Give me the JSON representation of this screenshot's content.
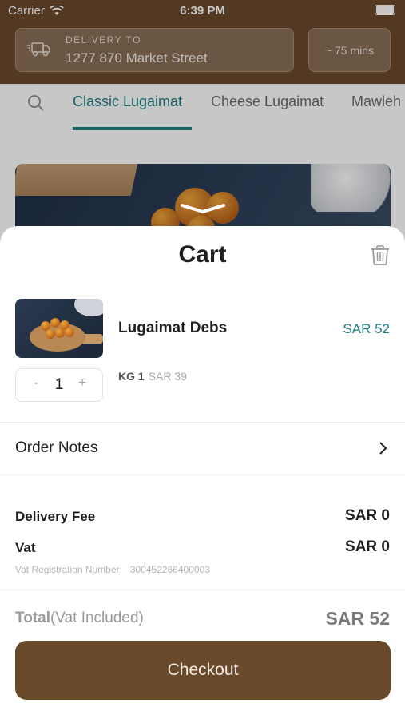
{
  "status_bar": {
    "carrier": "Carrier",
    "time": "6:39 PM"
  },
  "header": {
    "delivery_label": "DELIVERY TO",
    "delivery_address": "1277 870 Market Street",
    "eta": "~ 75 mins"
  },
  "tabs": [
    {
      "label": "Classic Lugaimat",
      "active": true
    },
    {
      "label": "Cheese Lugaimat",
      "active": false
    },
    {
      "label": "Mawleh",
      "active": false
    }
  ],
  "colors": {
    "brand_brown": "#6b4a2c",
    "accent_teal": "#1f7d82"
  },
  "cart": {
    "title": "Cart",
    "item": {
      "name": "Lugaimat Debs",
      "price": "SAR 52",
      "quantity": "1",
      "unit": "KG 1",
      "unit_price": "SAR 39",
      "minus": "-",
      "plus": "+"
    },
    "order_notes_label": "Order Notes",
    "delivery_fee_label": "Delivery Fee",
    "delivery_fee_value": "SAR 0",
    "vat_label": "Vat",
    "vat_value": "SAR 0",
    "vat_reg_label": "Vat Registration Number:",
    "vat_reg_number": "300452266400003",
    "total_label": "Total",
    "total_suffix": "(Vat Included)",
    "total_value": "SAR 52",
    "checkout_label": "Checkout"
  },
  "icons": [
    "wifi-icon",
    "battery-icon",
    "truck-icon",
    "search-icon",
    "chevron-down-icon",
    "trash-icon",
    "chevron-right-icon"
  ]
}
